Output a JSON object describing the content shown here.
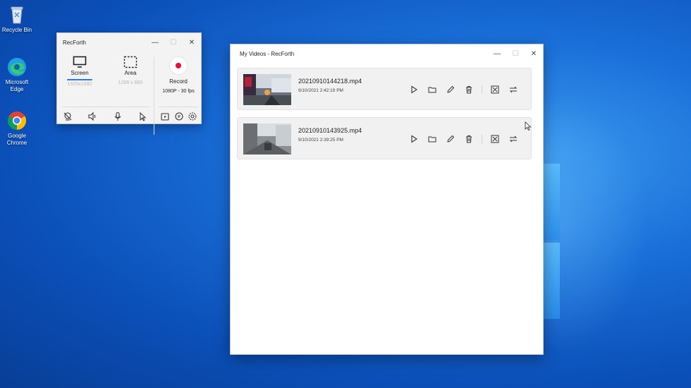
{
  "desktop": {
    "icons": [
      {
        "name": "recycle-bin",
        "label": "Recycle Bin"
      },
      {
        "name": "microsoft-edge",
        "label": "Microsoft Edge"
      },
      {
        "name": "google-chrome",
        "label": "Google Chrome"
      }
    ]
  },
  "recforth": {
    "title": "RecForth",
    "modes": [
      {
        "label": "Screen",
        "sub": "1920x1080",
        "selected": true
      },
      {
        "label": "Area",
        "sub": "1266 x 880",
        "selected": false
      }
    ],
    "record": {
      "label": "Record",
      "quality": "1080P - 30 fps"
    },
    "toolbar_icons": [
      "webcam-off-icon",
      "speaker-icon",
      "microphone-icon",
      "cursor-icon",
      "videos-icon",
      "feedback-icon",
      "settings-icon"
    ]
  },
  "my_videos": {
    "title": "My Videos - RecForth",
    "videos": [
      {
        "filename": "20210910144218.mp4",
        "date": "9/10/2021 2:42:19 PM"
      },
      {
        "filename": "20210910143925.mp4",
        "date": "9/10/2021 2:39:25 PM"
      }
    ],
    "actions": [
      "play-icon",
      "open-folder-icon",
      "edit-icon",
      "delete-icon",
      "compress-icon",
      "convert-icon"
    ]
  },
  "colors": {
    "accent": "#2d7be0",
    "record_red": "#e8112d",
    "desktop_blue": "#0b4fb8"
  }
}
